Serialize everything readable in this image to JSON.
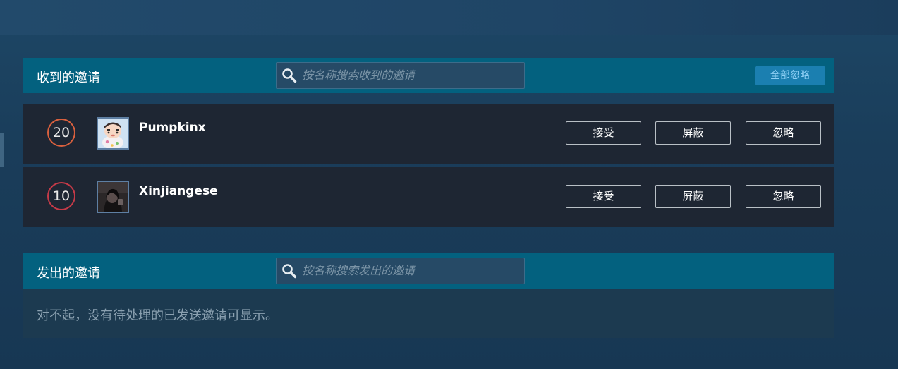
{
  "received": {
    "title": "收到的邀请",
    "search_placeholder": "按名称搜索收到的邀请",
    "ignore_all_label": "全部忽略",
    "invites": [
      {
        "level": "20",
        "name": "Pumpkinx",
        "accept_label": "接受",
        "block_label": "屏蔽",
        "ignore_label": "忽略"
      },
      {
        "level": "10",
        "name": "Xinjiangese",
        "accept_label": "接受",
        "block_label": "屏蔽",
        "ignore_label": "忽略"
      }
    ]
  },
  "sent": {
    "title": "发出的邀请",
    "search_placeholder": "按名称搜索发出的邀请",
    "empty_message": "对不起，没有待处理的已发送邀请可显示。"
  },
  "icons": {
    "search": "search-icon",
    "avatar_1": "avatar-cartoon",
    "avatar_2": "avatar-dark-photo"
  },
  "colors": {
    "header_bg": "#03617f",
    "row_bg": "#1e2633",
    "level_20_ring": "#d9603e",
    "level_10_ring": "#c53a48",
    "ignore_all_bg": "#1b7fb0"
  }
}
